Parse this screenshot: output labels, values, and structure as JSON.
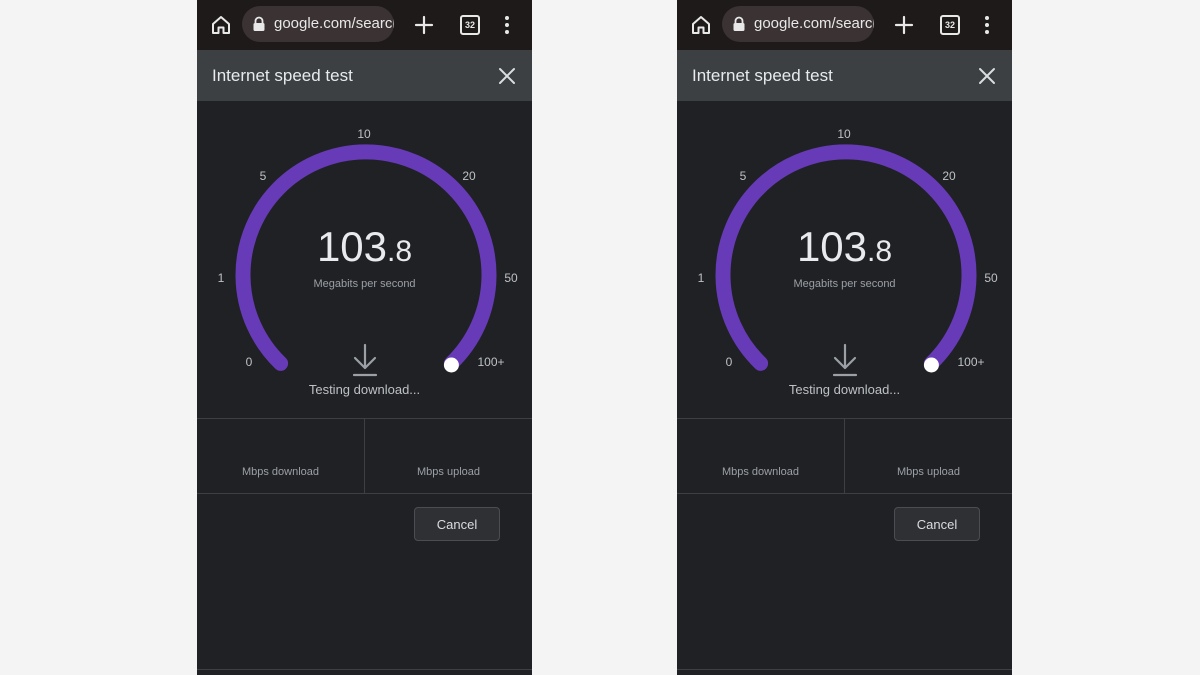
{
  "browser": {
    "url": "google.com/search",
    "tab_count": "32"
  },
  "dialog": {
    "title": "Internet speed test"
  },
  "gauge": {
    "ticks": [
      "0",
      "1",
      "5",
      "10",
      "20",
      "50",
      "100+"
    ],
    "speed_integer": "103",
    "speed_decimal": ".8",
    "unit_label": "Megabits per second",
    "status": "Testing download...",
    "accent_color": "#673ab7"
  },
  "results": {
    "download_label": "Mbps download",
    "upload_label": "Mbps upload"
  },
  "actions": {
    "cancel_label": "Cancel"
  }
}
